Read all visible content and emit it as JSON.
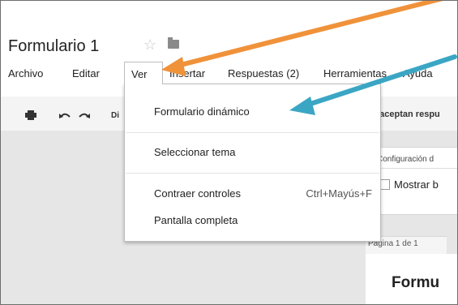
{
  "app": {
    "title": "Formulario 1",
    "star_icon": "☆",
    "folder_icon": "folder-icon"
  },
  "menubar": {
    "items": [
      {
        "label": "Archivo"
      },
      {
        "label": "Editar"
      },
      {
        "label": "Ver"
      },
      {
        "label": "Insertar"
      },
      {
        "label": "Respuestas (2)"
      },
      {
        "label": "Herramientas"
      },
      {
        "label": "Ayuda"
      }
    ]
  },
  "toolbar": {
    "print_icon": "print-icon",
    "undo_icon": "undo-icon",
    "redo_icon": "redo-icon",
    "truncated_label": "Di",
    "accept_text": "e aceptan respu"
  },
  "ver_menu": {
    "items": [
      {
        "label": "Formulario dinámico",
        "shortcut": ""
      },
      {
        "label": "Seleccionar tema",
        "shortcut": ""
      },
      {
        "label": "Contraer controles",
        "shortcut": "Ctrl+Mayús+F"
      },
      {
        "label": "Pantalla completa",
        "shortcut": ""
      }
    ]
  },
  "settings": {
    "title": "Configuración d",
    "checkbox_label": "Mostrar b"
  },
  "page": {
    "page_label": "Página 1 de 1",
    "heading": "Formu"
  },
  "colors": {
    "orange_arrow": "#f0923a",
    "blue_arrow": "#3aa6c4"
  }
}
